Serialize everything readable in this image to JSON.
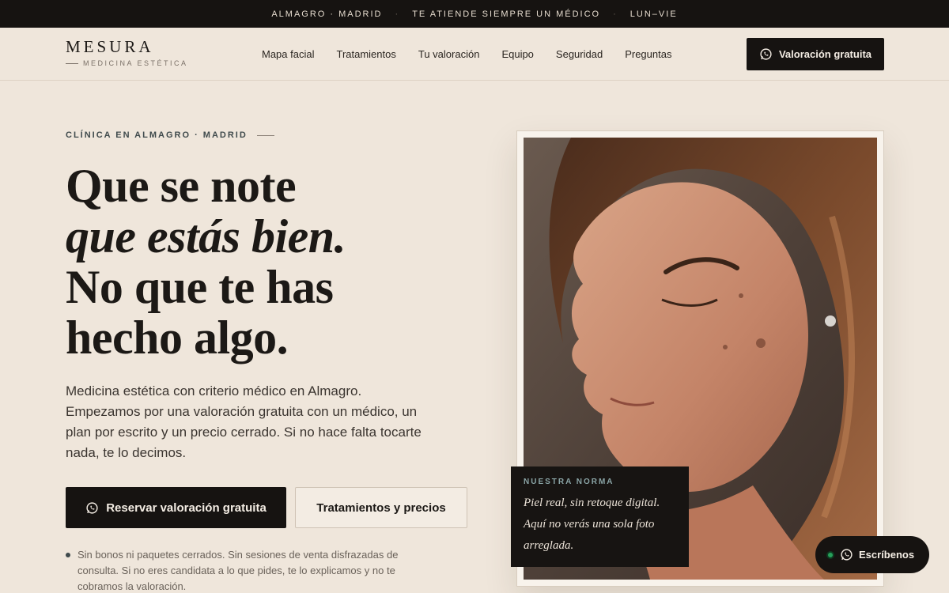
{
  "topbar": {
    "items": [
      "ALMAGRO · MADRID",
      "TE ATIENDE SIEMPRE UN MÉDICO",
      "LUN–VIE"
    ],
    "separator": "·"
  },
  "brand": {
    "name": "MESURA",
    "tagline": "MEDICINA ESTÉTICA"
  },
  "nav": {
    "items": [
      "Mapa facial",
      "Tratamientos",
      "Tu valoración",
      "Equipo",
      "Seguridad",
      "Preguntas"
    ]
  },
  "header_cta": {
    "label": "Valoración gratuita",
    "icon": "whatsapp-icon"
  },
  "hero": {
    "eyebrow": "CLÍNICA EN ALMAGRO · MADRID",
    "headline_line1": "Que se note",
    "headline_line2": "que estás bien.",
    "headline_line3": "No que te has",
    "headline_line4": "hecho algo.",
    "lead": "Medicina estética con criterio médico en Almagro. Empezamos por una valoración gratuita con un médico, un plan por escrito y un precio cerrado. Si no hace falta tocarte nada, te lo decimos.",
    "primary_button": "Reservar valoración gratuita",
    "secondary_button": "Tratamientos y precios",
    "note": "Sin bonos ni paquetes cerrados. Sin sesiones de venta disfrazadas de consulta. Si no eres candidata a lo que pides, te lo explicamos y no te cobramos la valoración."
  },
  "norma": {
    "label": "NUESTRA NORMA",
    "text": "Piel real, sin retoque digital. Aquí no verás una sola foto arreglada."
  },
  "chat": {
    "label": "Escríbenos",
    "status_color": "#27a05a"
  },
  "colors": {
    "background": "#efe6db",
    "dark": "#161311",
    "accent": "#3f4a4c"
  }
}
